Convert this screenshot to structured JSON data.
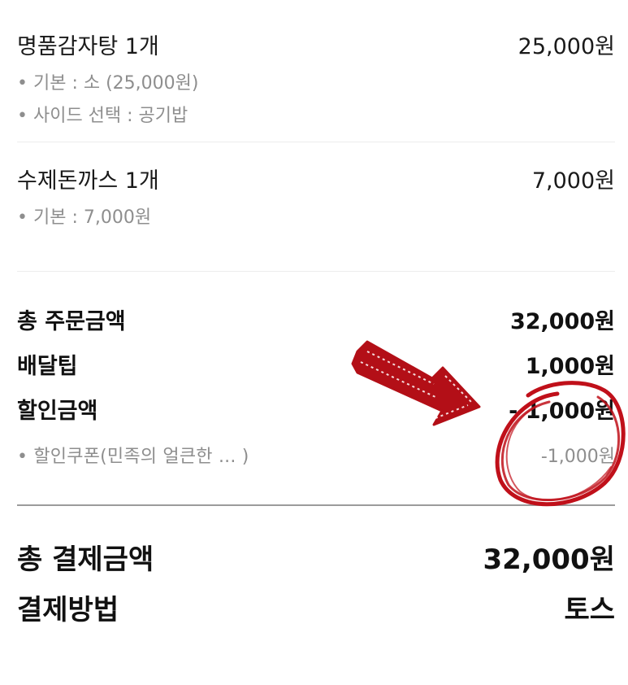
{
  "order_items": [
    {
      "name": "명품감자탕 1개",
      "price": "25,000원",
      "options": [
        "• 기본 : 소 (25,000원)",
        "• 사이드 선택 : 공기밥"
      ]
    },
    {
      "name": "수제돈까스 1개",
      "price": "7,000원",
      "options": [
        "• 기본 : 7,000원"
      ]
    }
  ],
  "summary": {
    "order_total_label": "총 주문금액",
    "order_total_value": "32,000원",
    "delivery_tip_label": "배달팁",
    "delivery_tip_value": "1,000원",
    "discount_label": "할인금액",
    "discount_value": "- 1,000원",
    "coupon_label": "• 할인쿠폰(민족의 얼큰한 ...   )",
    "coupon_value": "-1,000원"
  },
  "payment": {
    "total_label": "총 결제금액",
    "total_value": "32,000원",
    "method_label": "결제방법",
    "method_value": "토스"
  },
  "colors": {
    "annotation_red": "#c0101a",
    "divider": "#9b9b9b",
    "muted_text": "#8e8e8e"
  }
}
